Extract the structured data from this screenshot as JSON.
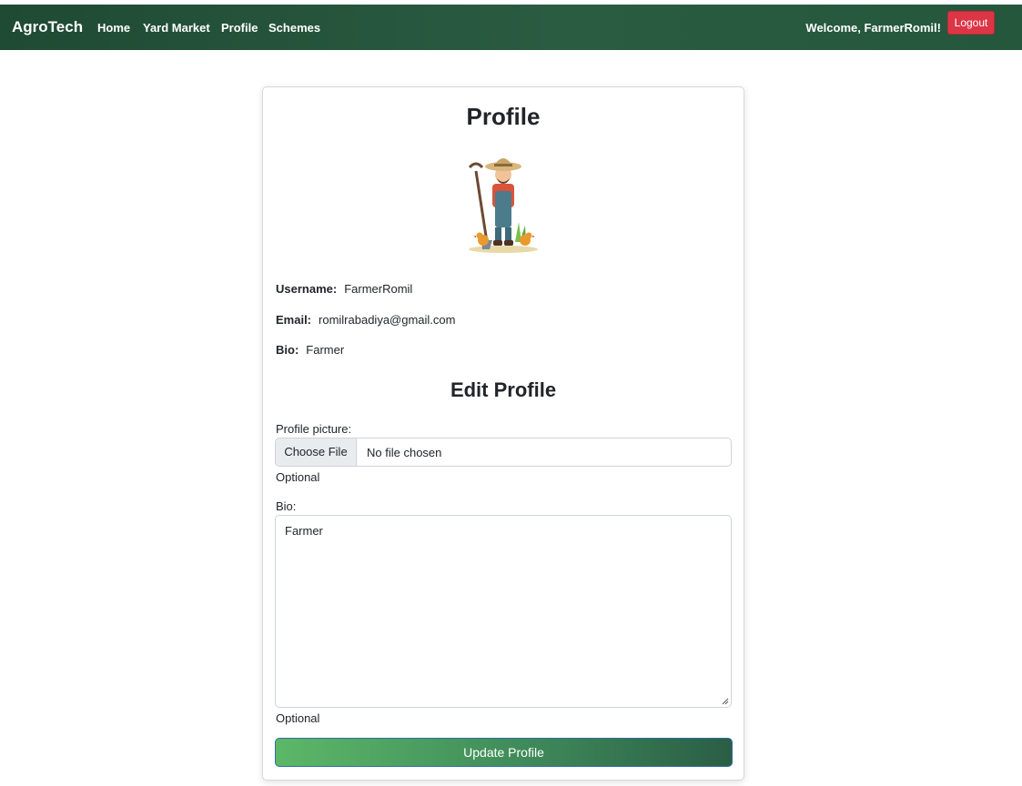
{
  "nav": {
    "brand": "AgroTech",
    "links": [
      "Home",
      "Yard Market",
      "Profile",
      "Schemes"
    ],
    "welcome": "Welcome, FarmerRomil!",
    "logout": "Logout"
  },
  "profile": {
    "title": "Profile",
    "avatar_icon": "farmer-illustration",
    "username_label": "Username:",
    "username": "FarmerRomil",
    "email_label": "Email:",
    "email": "romilrabadiya@gmail.com",
    "bio_label": "Bio:",
    "bio": "Farmer"
  },
  "edit": {
    "title": "Edit Profile",
    "picture_label": "Profile picture:",
    "choose_file": "Choose File",
    "no_file": "No file chosen",
    "picture_help": "Optional",
    "bio_label": "Bio:",
    "bio_value": "Farmer",
    "bio_help": "Optional",
    "submit": "Update Profile"
  },
  "colors": {
    "navbar": "#24573c",
    "logout": "#dc3545",
    "button_start": "#5cb868",
    "button_end": "#2a5e45"
  }
}
